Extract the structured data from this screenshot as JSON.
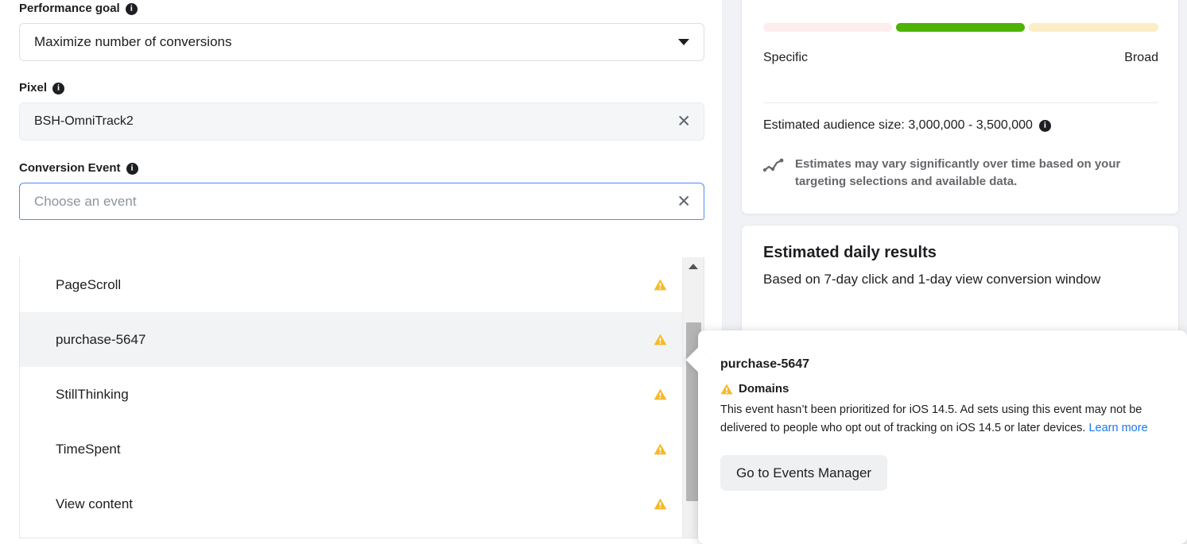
{
  "form": {
    "performance_goal": {
      "label": "Performance goal",
      "info_glyph": "i",
      "selected": "Maximize number of conversions",
      "caret": "chevron-down-icon"
    },
    "pixel": {
      "label": "Pixel",
      "info_glyph": "i",
      "value": "BSH-OmniTrack2",
      "clear": "✕"
    },
    "conversion_event": {
      "label": "Conversion Event",
      "info_glyph": "i",
      "placeholder": "Choose an event",
      "value": "",
      "clear": "✕"
    }
  },
  "dropdown": {
    "items": [
      {
        "label": "PageScroll",
        "warning": true,
        "highlighted": false
      },
      {
        "label": "purchase-5647",
        "warning": true,
        "highlighted": true
      },
      {
        "label": "StillThinking",
        "warning": true,
        "highlighted": false
      },
      {
        "label": "TimeSpent",
        "warning": true,
        "highlighted": false
      },
      {
        "label": "View content",
        "warning": true,
        "highlighted": false
      }
    ],
    "scrollbar": {
      "arrow_up": "▲"
    }
  },
  "audience": {
    "meter": {
      "segments": [
        {
          "name": "specific-segment",
          "color": "#fdeded"
        },
        {
          "name": "balanced-segment",
          "color": "#4eb304"
        },
        {
          "name": "broad-segment",
          "color": "#fcedc7"
        }
      ],
      "left_label": "Specific",
      "right_label": "Broad"
    },
    "estimated_size_label": "Estimated audience size: 3,000,000 - 3,500,000",
    "estimated_size_info_glyph": "i",
    "note": "Estimates may vary significantly over time based on your targeting selections and available data."
  },
  "daily_results": {
    "title": "Estimated daily results",
    "subtitle": "Based on 7-day click and 1-day view conversion window"
  },
  "tooltip": {
    "title": "purchase-5647",
    "heading": "Domains",
    "body": "This event hasn’t been prioritized for iOS 14.5. Ad sets using this event may not be delivered to people who opt out of tracking on iOS 14.5 or later devices. ",
    "link": "Learn more",
    "button": "Go to Events Manager"
  },
  "colors": {
    "accent_blue": "#1877f2",
    "focus_blue": "#4a8cf7",
    "warning_amber": "#f7b928",
    "meter_green": "#4eb304",
    "meter_pink": "#fdeded",
    "meter_yellow": "#fcedc7",
    "text_primary": "#1c1e21",
    "text_secondary": "#65676b"
  }
}
